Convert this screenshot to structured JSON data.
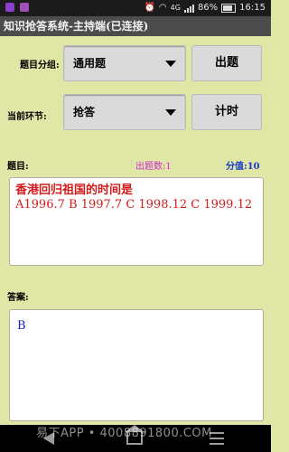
{
  "status_bar": {
    "network": "4G",
    "battery": "86%",
    "time": "16:15"
  },
  "app": {
    "title": "知识抢答系统-主持端(已连接)"
  },
  "controls": {
    "group_label": "题目分组:",
    "group_value": "通用题",
    "question_button": "出题",
    "stage_label": "当前环节:",
    "stage_value": "抢答",
    "timer_button": "计时"
  },
  "question_section": {
    "label": "题目:",
    "count_label": "出题数:1",
    "score_label": "分值:10",
    "title": "香港回归祖国的时间是",
    "options": "A1996.7   B 1997.7  C 1998.12  C 1999.12"
  },
  "answer_section": {
    "label": "答案:",
    "value": "B"
  },
  "watermark": "易下APP • 4008891800.COM",
  "colors": {
    "background": "#dfe6a6",
    "question_text": "#d21a1a",
    "answer_text": "#1a1ac8",
    "count_text": "#d22ad2",
    "score_text": "#1a3acb"
  }
}
